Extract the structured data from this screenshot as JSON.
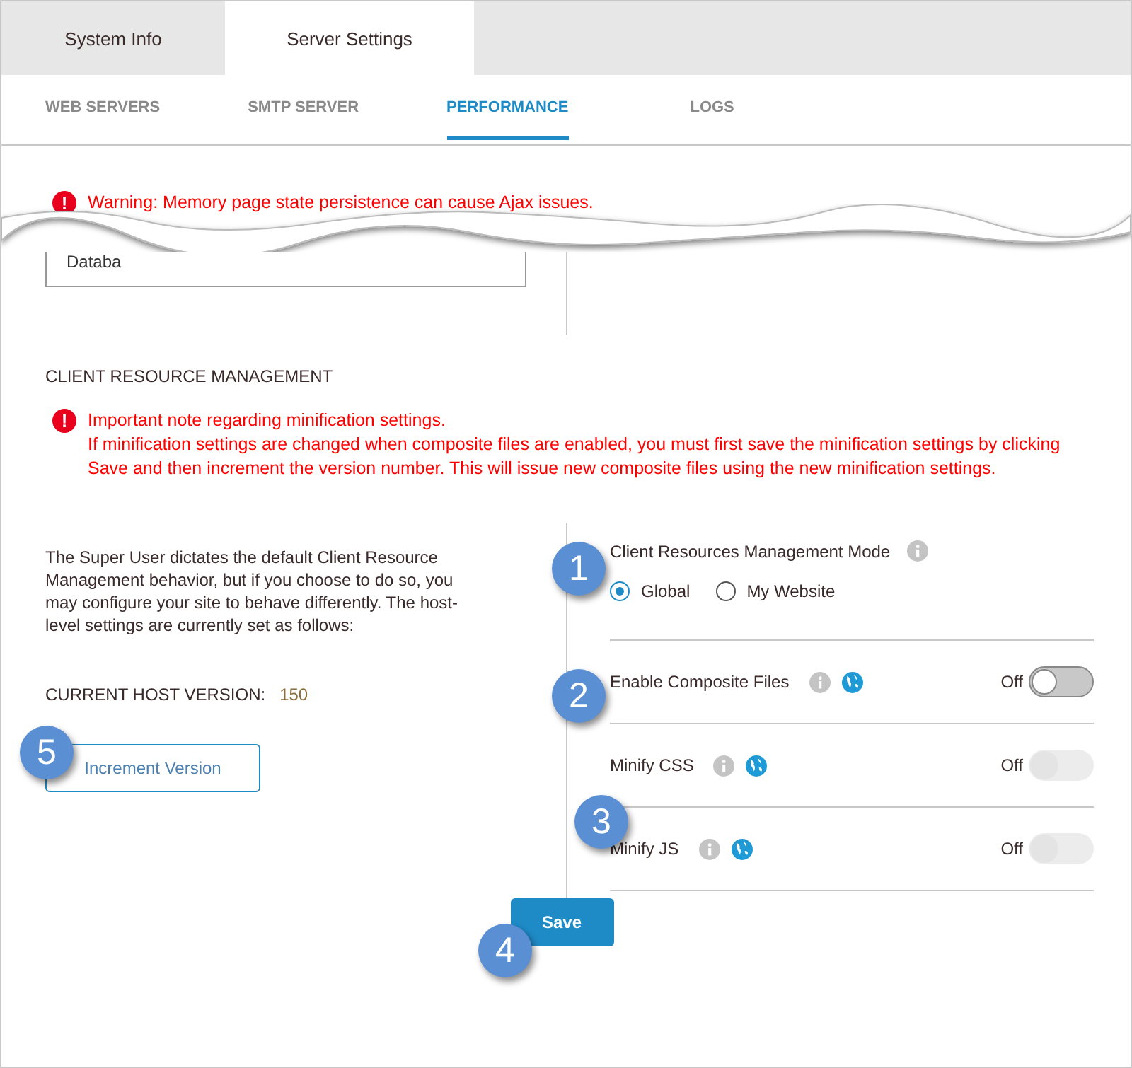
{
  "tabs": [
    {
      "label": "System Info",
      "selected": false
    },
    {
      "label": "Server Settings",
      "selected": true
    }
  ],
  "subtabs": [
    {
      "label": "WEB SERVERS",
      "selected": false
    },
    {
      "label": "SMTP SERVER",
      "selected": false
    },
    {
      "label": "PERFORMANCE",
      "selected": true
    },
    {
      "label": "LOGS",
      "selected": false
    }
  ],
  "warning": {
    "icon": "!",
    "text": "Warning: Memory page state persistence can cause Ajax issues."
  },
  "cut_field": {
    "value": "Databa"
  },
  "section_title": "CLIENT RESOURCE MANAGEMENT",
  "note": {
    "icon": "!",
    "lines": [
      "Important note regarding minification settings.",
      "If minification settings are changed when composite files are enabled, you must first save the minification settings by clicking Save and then increment the version number. This will issue new composite files using the new minification settings."
    ]
  },
  "description": "The Super User dictates the default Client Resource Management behavior, but if you choose to do so, you may configure your site to behave differently. The host-level settings are currently set as follows:",
  "host_version": {
    "label": "CURRENT HOST VERSION:",
    "value": "150"
  },
  "increment_button": "Increment Version",
  "mode": {
    "label": "Client Resources Management Mode",
    "options": [
      {
        "label": "Global",
        "selected": true
      },
      {
        "label": "My Website",
        "selected": false
      }
    ]
  },
  "switches": [
    {
      "label": "Enable Composite Files",
      "state": "Off",
      "on": false,
      "disabled": false
    },
    {
      "label": "Minify CSS",
      "state": "Off",
      "on": false,
      "disabled": true
    },
    {
      "label": "Minify JS",
      "state": "Off",
      "on": false,
      "disabled": true
    }
  ],
  "save_button": "Save",
  "callouts": [
    "1",
    "2",
    "3",
    "4",
    "5"
  ]
}
